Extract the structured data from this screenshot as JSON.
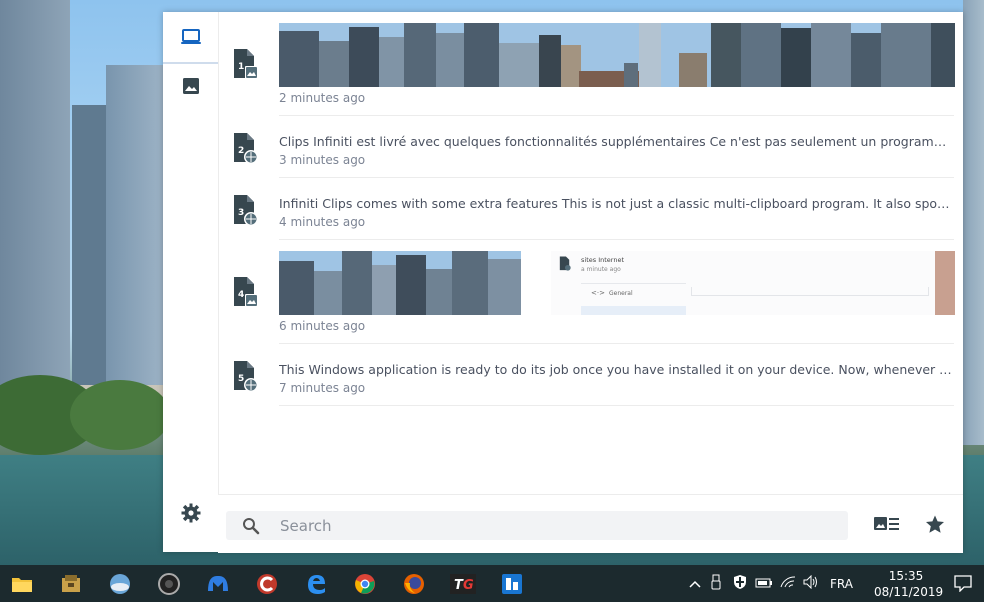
{
  "sidebar": {
    "items": [
      {
        "name": "clipboard-device",
        "icon": "laptop-icon",
        "active": true
      },
      {
        "name": "images",
        "icon": "image-icon",
        "active": false
      }
    ],
    "settings_icon": "gear-icon"
  },
  "clips": [
    {
      "number": "1",
      "kind": "image",
      "time": "2 minutes ago"
    },
    {
      "number": "2",
      "kind": "web",
      "text": "Clips Infiniti est livré avec quelques fonctionnalités supplémentaires  Ce n'est pas seulement un programme multi-presse-papiers classique.",
      "time": "3 minutes ago"
    },
    {
      "number": "3",
      "kind": "web",
      "text": "Infiniti Clips comes with some extra features  This is not just a classic multi-clipboard program. It also sports some great features.",
      "time": "4 minutes ago"
    },
    {
      "number": "4",
      "kind": "image",
      "time": "6 minutes ago",
      "preview": {
        "title": "sites Internet",
        "subtitle": "a minute ago",
        "menu_item": "General"
      }
    },
    {
      "number": "5",
      "kind": "web",
      "text": "This Windows application is ready to do its job once you have installed it on your device. Now, whenever you copy a text or an image, it is saved.",
      "time": "7 minutes ago"
    }
  ],
  "search": {
    "placeholder": "Search"
  },
  "bottom_icons": [
    "view-toggle-icon",
    "star-icon"
  ],
  "taskbar": {
    "language": "FRA",
    "time": "15:35",
    "date": "08/11/2019",
    "apps": [
      "file-explorer-icon",
      "archive-icon",
      "weather-icon",
      "webcam-icon",
      "malwarebytes-icon",
      "ccleaner-icon",
      "edge-icon",
      "chrome-icon",
      "firefox-icon",
      "tg-icon",
      "app-icon"
    ]
  },
  "colors": {
    "accent": "#1565c0",
    "icon_gray": "#4a5568",
    "text": "#4a5160",
    "muted": "#7c8494"
  }
}
